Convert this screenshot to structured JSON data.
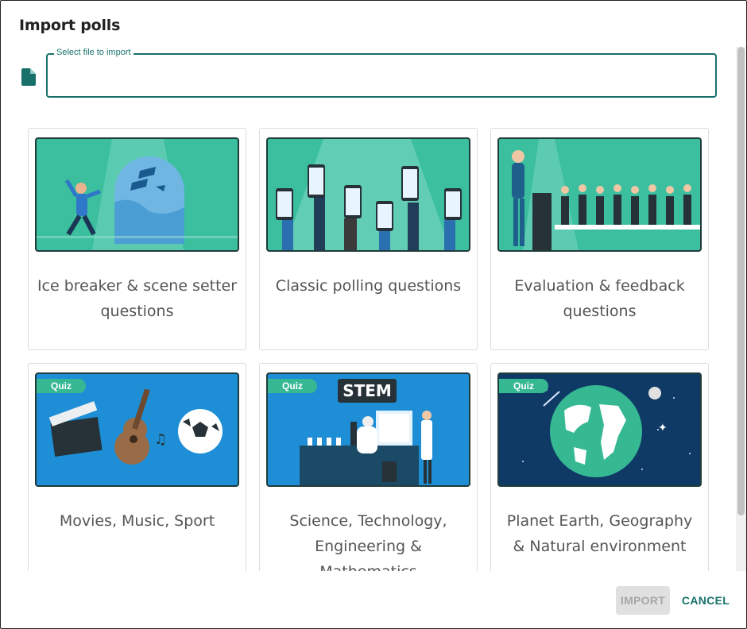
{
  "dialog": {
    "title": "Import polls",
    "file_field": {
      "label": "Select file to import",
      "value": ""
    },
    "cards": [
      {
        "label": "Ice breaker & scene setter questions",
        "tag": ""
      },
      {
        "label": "Classic polling questions",
        "tag": ""
      },
      {
        "label": "Evaluation & feedback questions",
        "tag": ""
      },
      {
        "label": "Movies, Music, Sport",
        "tag": "Quiz"
      },
      {
        "label": "Science, Technology, Engineering & Mathematics",
        "tag": "Quiz",
        "banner": "STEM"
      },
      {
        "label": "Planet Earth, Geography & Natural environment",
        "tag": "Quiz"
      }
    ],
    "buttons": {
      "import": "IMPORT",
      "cancel": "CANCEL"
    }
  },
  "colors": {
    "accent": "#17706a",
    "teal_bg": "#3bbf9f",
    "blue_bg": "#1e8fd6",
    "navy_bg": "#0f3a66",
    "quiz_tag": "#36b893"
  }
}
